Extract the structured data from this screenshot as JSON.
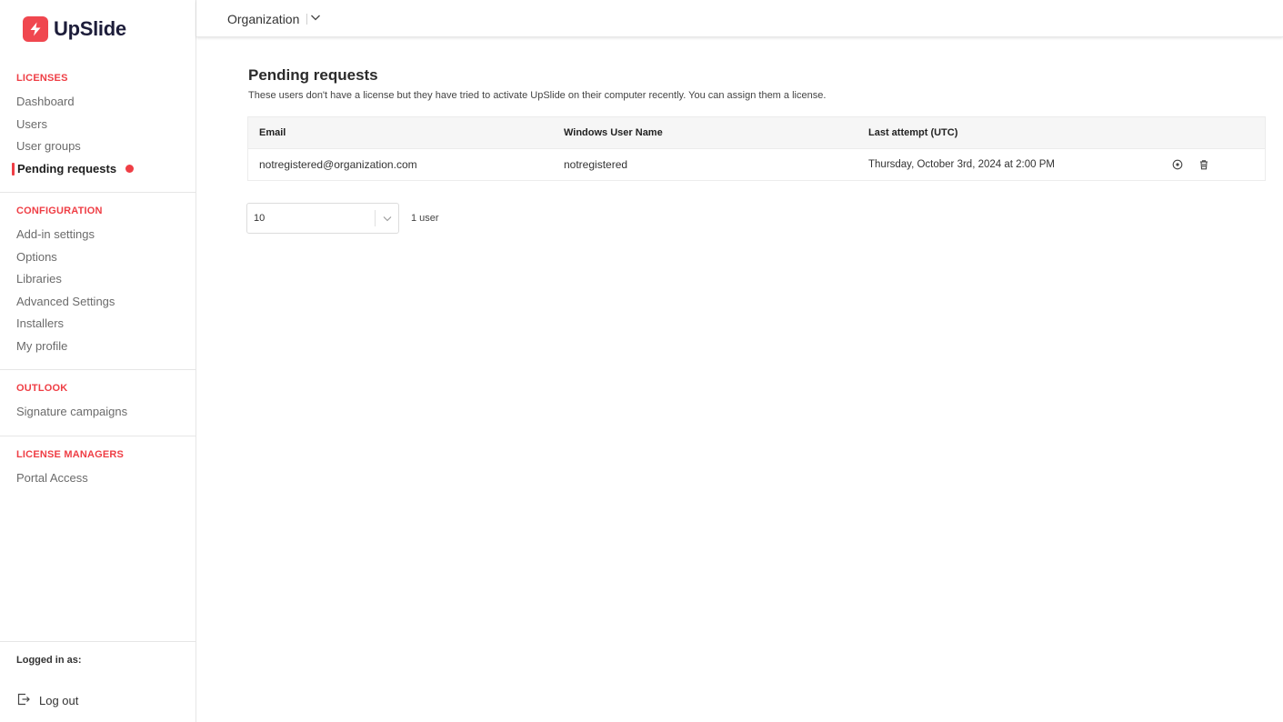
{
  "app": {
    "name": "UpSlide"
  },
  "topbar": {
    "org_label": "Organization"
  },
  "sidebar": {
    "sections": [
      {
        "title": "LICENSES",
        "items": [
          "Dashboard",
          "Users",
          "User groups",
          "Pending requests"
        ]
      },
      {
        "title": "CONFIGURATION",
        "items": [
          "Add-in settings",
          "Options",
          "Libraries",
          "Advanced Settings",
          "Installers",
          "My profile"
        ]
      },
      {
        "title": "OUTLOOK",
        "items": [
          "Signature campaigns"
        ]
      },
      {
        "title": "LICENSE MANAGERS",
        "items": [
          "Portal Access"
        ]
      }
    ],
    "active_item": "Pending requests",
    "logged_in_label": "Logged in as:",
    "logout_label": "Log out"
  },
  "main": {
    "title": "Pending requests",
    "description": "These users don't have a license but they have tried to activate UpSlide on their computer recently. You can assign them a license.",
    "table": {
      "headers": [
        "Email",
        "Windows User Name",
        "Last attempt (UTC)"
      ],
      "rows": [
        {
          "email": "notregistered@organization.com",
          "username": "notregistered",
          "last_attempt": "Thursday, October 3rd, 2024 at 2:00 PM"
        }
      ],
      "row_actions": [
        "assign-license-icon",
        "trash-icon"
      ]
    },
    "pagination": {
      "page_size": "10",
      "count_label": "1 user"
    }
  },
  "colors": {
    "accent": "#ef3e45",
    "brand": "#1d1d3a"
  }
}
